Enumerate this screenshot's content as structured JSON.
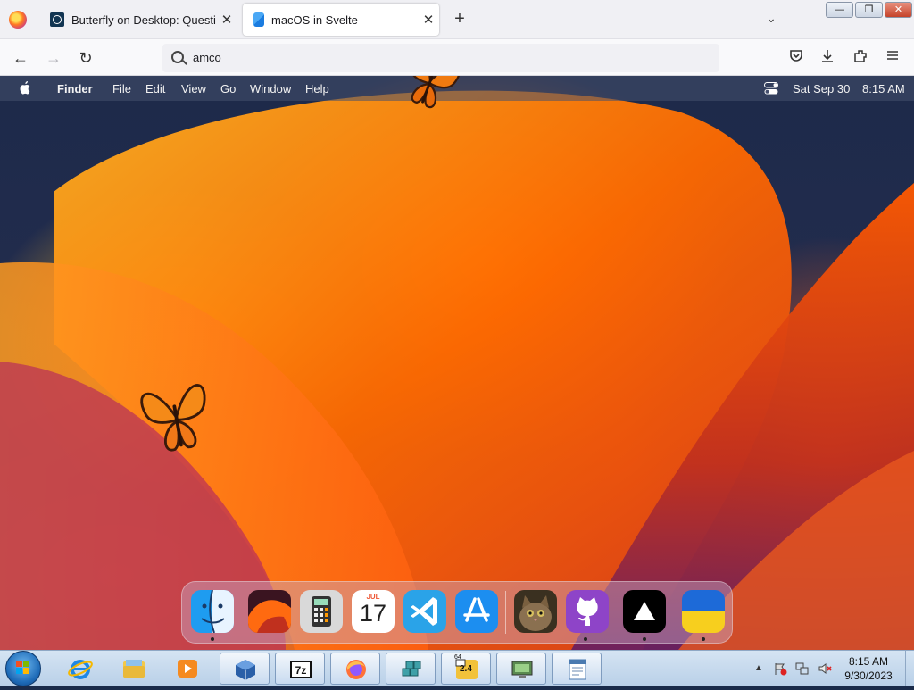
{
  "browser": {
    "tabs": [
      {
        "title": "Butterfly on Desktop: Questions",
        "favicon": "questions-favicon-icon",
        "active": false
      },
      {
        "title": "macOS in Svelte",
        "favicon": "svelte-favicon-icon",
        "active": true
      }
    ],
    "url": "amco",
    "window_buttons": {
      "minimize": "—",
      "maximize": "❐",
      "close": "✕"
    },
    "nav": {
      "back": "←",
      "forward": "→",
      "reload": "↻"
    },
    "toolbar_icons": {
      "pocket": "pocket-icon",
      "downloads": "download-icon",
      "extensions": "extensions-icon",
      "menu": "hamburger-menu-icon"
    }
  },
  "mac_menubar": {
    "app_name": "Finder",
    "menus": [
      "File",
      "Edit",
      "View",
      "Go",
      "Window",
      "Help"
    ],
    "date": "Sat Sep 30",
    "time": "8:15 AM"
  },
  "dock": {
    "apps": [
      {
        "name": "finder-icon",
        "running": true
      },
      {
        "name": "macos-ventura-wallpaper-icon",
        "running": false
      },
      {
        "name": "calculator-icon",
        "running": false
      },
      {
        "name": "calendar-icon",
        "running": false,
        "month": "JUL",
        "day": "17"
      },
      {
        "name": "vscode-icon",
        "running": false
      },
      {
        "name": "app-store-icon",
        "running": false
      },
      {
        "name": "cat-photo-icon",
        "running": true
      },
      {
        "name": "github-icon",
        "running": true
      },
      {
        "name": "vercel-icon",
        "running": true
      },
      {
        "name": "ukraine-flag-icon",
        "running": true
      }
    ]
  },
  "taskbar": {
    "items": [
      {
        "name": "internet-explorer-icon",
        "active": false
      },
      {
        "name": "file-explorer-icon",
        "active": false
      },
      {
        "name": "media-player-icon",
        "active": false
      },
      {
        "name": "virtualbox-icon",
        "active": true
      },
      {
        "name": "7zip-icon",
        "active": true
      },
      {
        "name": "firefox-icon",
        "active": true
      },
      {
        "name": "registry-cubes-icon",
        "active": true
      },
      {
        "name": "cpu-z-icon",
        "active": true,
        "badge_top": "64",
        "badge_value": "2.4"
      },
      {
        "name": "device-manager-icon",
        "active": true
      },
      {
        "name": "wordpad-icon",
        "active": true
      }
    ],
    "clock_time": "8:15 AM",
    "clock_date": "9/30/2023"
  },
  "colors": {
    "tab_bar": "#f0f0f4",
    "menu_bar": "#46506e",
    "taskbar": "#c5daee"
  }
}
